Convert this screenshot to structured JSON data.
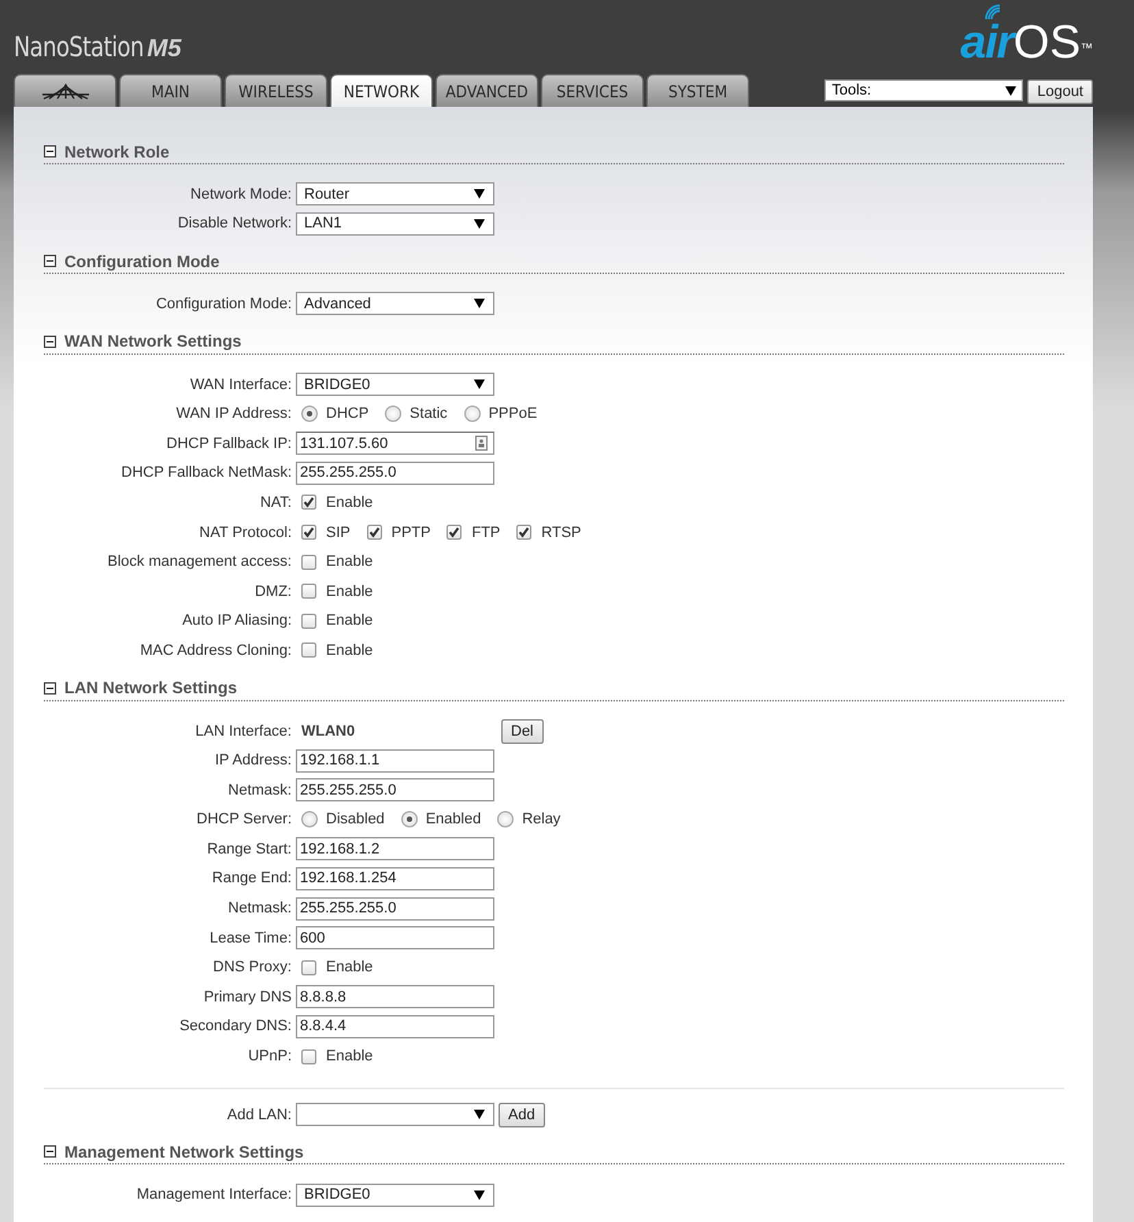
{
  "header": {
    "product": "NanoStation",
    "model": "M5",
    "logo_main": "air",
    "logo_os": "OS",
    "logo_tm": "™"
  },
  "tabs": [
    {
      "kind": "logo",
      "selected": false
    },
    {
      "label": "MAIN",
      "kind": "text",
      "selected": false
    },
    {
      "label": "WIRELESS",
      "kind": "text",
      "selected": false
    },
    {
      "label": "NETWORK",
      "kind": "text",
      "selected": true
    },
    {
      "label": "ADVANCED",
      "kind": "text",
      "selected": false
    },
    {
      "label": "SERVICES",
      "kind": "text",
      "selected": false
    },
    {
      "label": "SYSTEM",
      "kind": "text",
      "selected": false
    }
  ],
  "tools": {
    "value": "Tools:",
    "button": "Logout"
  },
  "sections": [
    {
      "title": "Network Role",
      "rows": [
        {
          "kind": "select",
          "label": "Network Mode:",
          "value": "Router"
        },
        {
          "kind": "select",
          "label": "Disable Network:",
          "value": "LAN1"
        }
      ]
    },
    {
      "title": "Configuration Mode",
      "rows": [
        {
          "kind": "select",
          "label": "Configuration Mode:",
          "value": "Advanced"
        }
      ]
    },
    {
      "title": "WAN Network Settings",
      "rows": [
        {
          "kind": "select",
          "label": "WAN Interface:",
          "value": "BRIDGE0"
        },
        {
          "kind": "radios",
          "label": "WAN IP Address:",
          "options": [
            {
              "label": "DHCP",
              "selected": true
            },
            {
              "label": "Static",
              "selected": false
            },
            {
              "label": "PPPoE",
              "selected": false
            }
          ]
        },
        {
          "kind": "text_key",
          "label": "DHCP Fallback IP:",
          "value": "131.107.5.60"
        },
        {
          "kind": "text",
          "label": "DHCP Fallback NetMask:",
          "value": "255.255.255.0"
        },
        {
          "kind": "checks",
          "label": "NAT:",
          "options": [
            {
              "label": "Enable",
              "checked": true
            }
          ]
        },
        {
          "kind": "checks",
          "label": "NAT Protocol:",
          "options": [
            {
              "label": "SIP",
              "checked": true
            },
            {
              "label": "PPTP",
              "checked": true
            },
            {
              "label": "FTP",
              "checked": true
            },
            {
              "label": "RTSP",
              "checked": true
            }
          ]
        },
        {
          "kind": "checks",
          "label": "Block management access:",
          "options": [
            {
              "label": "Enable",
              "checked": false
            }
          ]
        },
        {
          "kind": "checks",
          "label": "DMZ:",
          "options": [
            {
              "label": "Enable",
              "checked": false
            }
          ]
        },
        {
          "kind": "checks",
          "label": "Auto IP Aliasing:",
          "options": [
            {
              "label": "Enable",
              "checked": false
            }
          ]
        },
        {
          "kind": "checks",
          "label": "MAC Address Cloning:",
          "options": [
            {
              "label": "Enable",
              "checked": false
            }
          ]
        }
      ]
    },
    {
      "title": "LAN Network Settings",
      "rows": [
        {
          "kind": "static_button",
          "label": "LAN Interface:",
          "value": "WLAN0",
          "button": "Del"
        },
        {
          "kind": "text",
          "label": "IP Address:",
          "value": "192.168.1.1"
        },
        {
          "kind": "text",
          "label": "Netmask:",
          "value": "255.255.255.0"
        },
        {
          "kind": "radios",
          "label": "DHCP Server:",
          "options": [
            {
              "label": "Disabled",
              "selected": false
            },
            {
              "label": "Enabled",
              "selected": true
            },
            {
              "label": "Relay",
              "selected": false
            }
          ]
        },
        {
          "kind": "text",
          "label": "Range Start:",
          "value": "192.168.1.2"
        },
        {
          "kind": "text",
          "label": "Range End:",
          "value": "192.168.1.254"
        },
        {
          "kind": "text",
          "label": "Netmask:",
          "value": "255.255.255.0"
        },
        {
          "kind": "text",
          "label": "Lease Time:",
          "value": "600"
        },
        {
          "kind": "checks",
          "label": "DNS Proxy:",
          "options": [
            {
              "label": "Enable",
              "checked": false
            }
          ]
        },
        {
          "kind": "text",
          "label": "Primary DNS",
          "value": "8.8.8.8"
        },
        {
          "kind": "text",
          "label": "Secondary DNS:",
          "value": "8.8.4.4"
        },
        {
          "kind": "checks",
          "label": "UPnP:",
          "options": [
            {
              "label": "Enable",
              "checked": false
            }
          ]
        },
        {
          "kind": "divider"
        },
        {
          "kind": "select_button",
          "label": "Add LAN:",
          "button": "Add"
        }
      ]
    },
    {
      "title": "Management Network Settings",
      "rows": [
        {
          "kind": "select",
          "label": "Management Interface:",
          "value": "BRIDGE0"
        }
      ]
    }
  ]
}
